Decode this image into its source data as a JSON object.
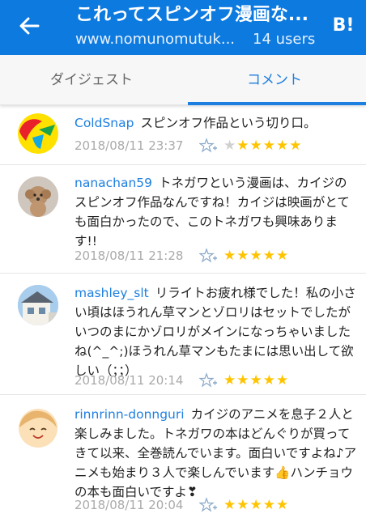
{
  "header": {
    "title": "これってスピンオフ漫画な...",
    "url": "www.nomunomutuk...",
    "users": "14 users",
    "hatena_badge": "B!"
  },
  "tabs": [
    {
      "label": "ダイジェスト",
      "active": false
    },
    {
      "label": "コメント",
      "active": true
    }
  ],
  "comments": [
    {
      "user": "ColdSnap",
      "text": "スピンオフ作品という切り口。",
      "date": "2018/08/11 23:37",
      "gray_star": "★",
      "stars": "★★★★★",
      "avatar": "colorful-logo"
    },
    {
      "user": "nanachan59",
      "text": "トネガワという漫画は、カイジのスピンオフ作品なんですね！カイジは映画がとても面白かったので、このトネガワも興味あります!!",
      "date": "2018/08/11 21:28",
      "stars": "★★★★★",
      "avatar": "dog-photo"
    },
    {
      "user": "mashley_slt",
      "text": "リライトお疲れ様でした！私の小さい頃はほうれん草マンとゾロリはセットでしたがいつのまにかゾロリがメインになっちゃいましたね(^_^;)ほうれん草マンもたまには思い出して欲しい（；；）",
      "date": "2018/08/11 20:14",
      "stars": "★★★★★",
      "avatar": "house-photo"
    },
    {
      "user": "rinnrinn-donnguri",
      "text": "カイジのアニメを息子２人と楽しみました。トネガワの本はどんぐりが買ってきて以来、全巻読んでいます。面白いですよね♪アニメも始まり３人で楽しんでいます👍ハンチョウの本も面白いですよ❣",
      "date": "2018/08/11 20:04",
      "stars": "★★★★★",
      "avatar": "smiling-face-drawing"
    }
  ],
  "colors": {
    "header": "#0d7ae0",
    "accent": "#1d7fe0",
    "star": "#ffc400"
  }
}
